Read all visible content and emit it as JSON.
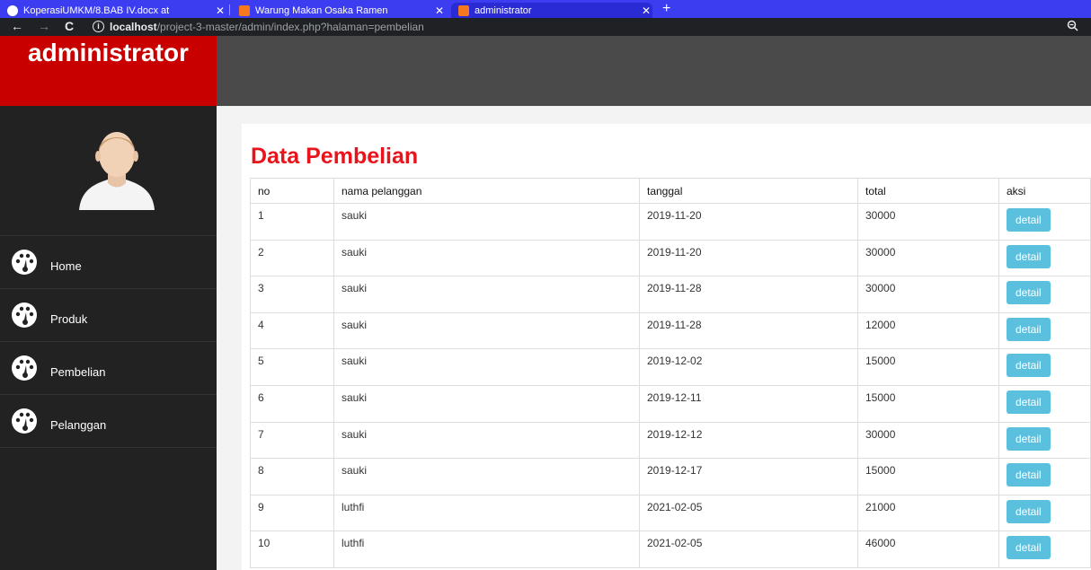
{
  "browser": {
    "tabs": [
      {
        "title": "KoperasiUMKM/8.BAB IV.docx at",
        "icon": "github-icon"
      },
      {
        "title": "Warung Makan Osaka Ramen",
        "icon": "xampp-icon"
      },
      {
        "title": "administrator",
        "icon": "xampp-icon"
      }
    ],
    "url_host": "localhost",
    "url_path": "/project-3-master/admin/index.php?halaman=pembelian"
  },
  "sidebar": {
    "brand": "administrator",
    "menu": [
      {
        "label": "Home",
        "icon": "dashboard-icon"
      },
      {
        "label": "Produk",
        "icon": "dashboard-icon"
      },
      {
        "label": "Pembelian",
        "icon": "dashboard-icon"
      },
      {
        "label": "Pelanggan",
        "icon": "dashboard-icon"
      }
    ]
  },
  "main": {
    "title": "Data Pembelian",
    "columns": [
      "no",
      "nama pelanggan",
      "tanggal",
      "total",
      "aksi"
    ],
    "rows": [
      {
        "no": "1",
        "nama": "sauki",
        "tanggal": "2019-11-20",
        "total": "30000"
      },
      {
        "no": "2",
        "nama": "sauki",
        "tanggal": "2019-11-20",
        "total": "30000"
      },
      {
        "no": "3",
        "nama": "sauki",
        "tanggal": "2019-11-28",
        "total": "30000"
      },
      {
        "no": "4",
        "nama": "sauki",
        "tanggal": "2019-11-28",
        "total": "12000"
      },
      {
        "no": "5",
        "nama": "sauki",
        "tanggal": "2019-12-02",
        "total": "15000"
      },
      {
        "no": "6",
        "nama": "sauki",
        "tanggal": "2019-12-11",
        "total": "15000"
      },
      {
        "no": "7",
        "nama": "sauki",
        "tanggal": "2019-12-12",
        "total": "30000"
      },
      {
        "no": "8",
        "nama": "sauki",
        "tanggal": "2019-12-17",
        "total": "15000"
      },
      {
        "no": "9",
        "nama": "luthfi",
        "tanggal": "2021-02-05",
        "total": "21000"
      },
      {
        "no": "10",
        "nama": "luthfi",
        "tanggal": "2021-02-05",
        "total": "46000"
      }
    ],
    "action_label": "detail"
  },
  "colors": {
    "brand_red": "#c90000",
    "title_red": "#e8141b",
    "button_info": "#5bc0de",
    "sidebar_bg": "#222222",
    "tab_strip": "#3c3cf0"
  }
}
